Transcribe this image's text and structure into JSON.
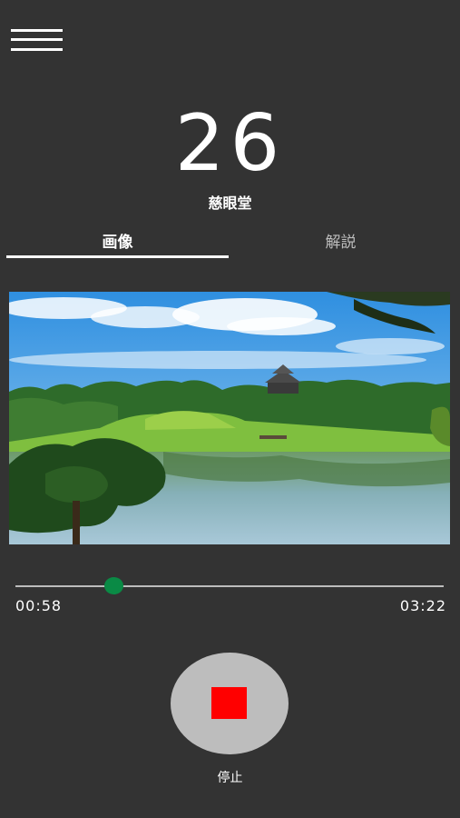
{
  "header": {
    "menu_icon": "hamburger-menu-icon"
  },
  "spot": {
    "number": "26",
    "name": "慈眼堂"
  },
  "tabs": [
    {
      "label": "画像",
      "active": true
    },
    {
      "label": "解説",
      "active": false
    }
  ],
  "player": {
    "elapsed": "00:58",
    "total": "03:22",
    "progress": 0.23,
    "stop_label": "停止",
    "stop_icon": "stop-icon"
  },
  "colors": {
    "background": "#333333",
    "progress_thumb": "#0a8a45",
    "stop_icon": "#ff0000",
    "stop_button": "#bdbdbd"
  }
}
